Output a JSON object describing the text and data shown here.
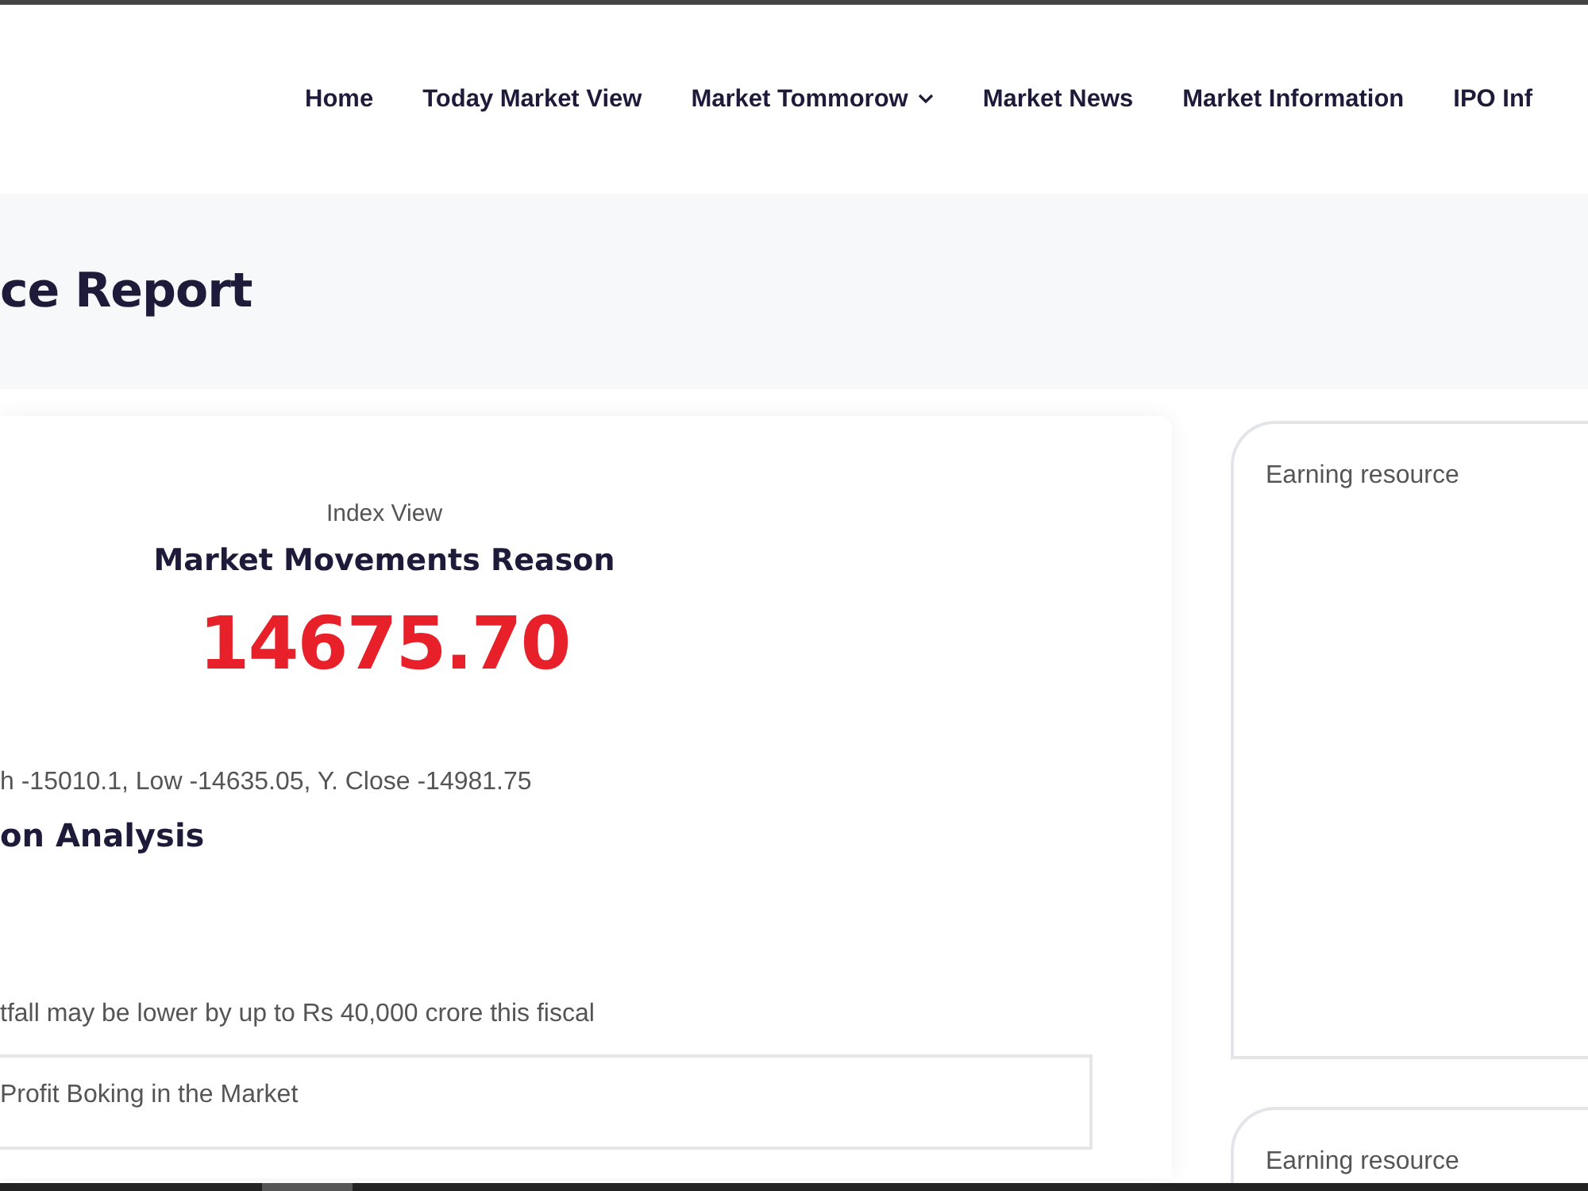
{
  "nav": [
    {
      "label": "Home",
      "has_dropdown": false
    },
    {
      "label": "Today Market View",
      "has_dropdown": false
    },
    {
      "label": "Market Tommorow",
      "has_dropdown": true
    },
    {
      "label": "Market News",
      "has_dropdown": false
    },
    {
      "label": "Market Information",
      "has_dropdown": false
    },
    {
      "label": "IPO Inf",
      "has_dropdown": false
    }
  ],
  "hero": {
    "title": "ce Report"
  },
  "main": {
    "eyebrow": "Index View",
    "heading": "Market Movements Reason",
    "value": "14675.70",
    "stats": "h -15010.1, Low -14635.05, Y. Close -14981.75",
    "section_title": "on Analysis",
    "news_line": "tfall may be lower by up to Rs 40,000 crore this fiscal",
    "box_text": "Profit Boking in the Market"
  },
  "sidebar": [
    {
      "title": "Earning resource"
    },
    {
      "title": "Earning resource"
    }
  ]
}
